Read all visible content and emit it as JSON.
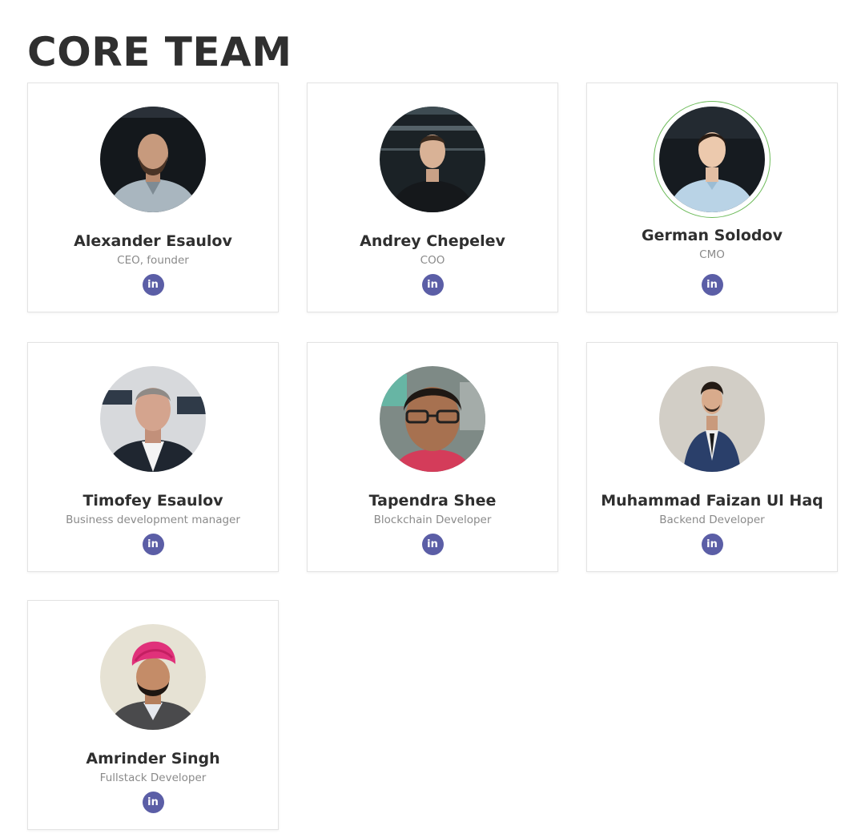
{
  "page": {
    "title": "CORE TEAM"
  },
  "linkedin_icon": "linkedin-icon",
  "colors": {
    "linkedin": "#5b5ea6",
    "highlight_ring": "#6dbb5a",
    "name": "#2f2f2f",
    "role": "#8a8a8a",
    "card_border": "#e3e3e3"
  },
  "members": [
    {
      "name": "Alexander Esaulov",
      "role": "CEO, founder",
      "linkedin_label": "in"
    },
    {
      "name": "Andrey Chepelev",
      "role": "COO",
      "linkedin_label": "in"
    },
    {
      "name": "German Solodov",
      "role": "CMO",
      "linkedin_label": "in"
    },
    {
      "name": "Timofey Esaulov",
      "role": "Business development manager",
      "linkedin_label": "in"
    },
    {
      "name": "Tapendra Shee",
      "role": "Blockchain Developer",
      "linkedin_label": "in"
    },
    {
      "name": "Muhammad Faizan Ul Haq",
      "role": "Backend Developer",
      "linkedin_label": "in"
    },
    {
      "name": "Amrinder Singh",
      "role": "Fullstack Developer",
      "linkedin_label": "in"
    }
  ]
}
